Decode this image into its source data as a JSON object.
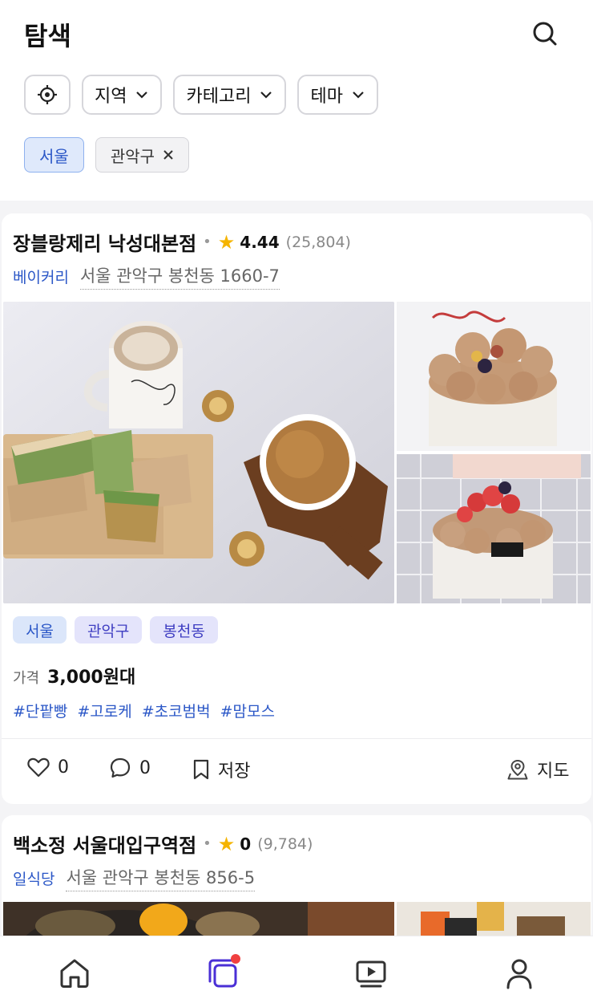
{
  "header": {
    "title": "탐색",
    "filters": {
      "region": "지역",
      "category": "카테고리",
      "theme": "테마"
    },
    "selected": {
      "city": "서울",
      "district": "관악구"
    }
  },
  "listings": [
    {
      "name": "장블랑제리 낙성대본점",
      "rating": "4.44",
      "review_count": "(25,804)",
      "category": "베이커리",
      "address": "서울 관악구 봉천동 1660-7",
      "region_tags": [
        "서울",
        "관악구",
        "봉천동"
      ],
      "price_label": "가격",
      "price_value": "3,000원대",
      "hashtags": [
        "#단팥빵",
        "#고로케",
        "#초코범벅",
        "#맘모스"
      ],
      "likes": "0",
      "comments": "0",
      "save_label": "저장",
      "map_label": "지도"
    },
    {
      "name": "백소정 서울대입구역점",
      "rating": "0",
      "review_count": "(9,784)",
      "category": "일식당",
      "address": "서울 관악구 봉천동 856-5"
    }
  ],
  "colors": {
    "accent": "#2b57c7",
    "star": "#f5b400",
    "badge": "#f04040",
    "nav_active": "#4a2fd6"
  },
  "nav": [
    "home-icon",
    "feed-icon",
    "video-icon",
    "profile-icon"
  ]
}
